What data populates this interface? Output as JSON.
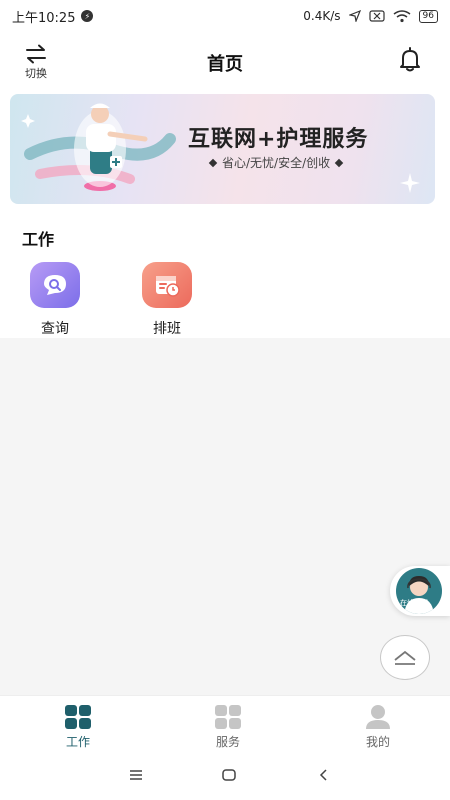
{
  "status": {
    "time": "上午10:25",
    "net_speed": "0.4K/s",
    "battery": "96"
  },
  "header": {
    "switch_label": "切换",
    "title": "首页"
  },
  "banner": {
    "title": "互联网+护理服务",
    "subtitle": "省心/无忧/安全/创收"
  },
  "work": {
    "section_title": "工作",
    "items": [
      {
        "label": "查询",
        "icon": "search-chat-icon"
      },
      {
        "label": "排班",
        "icon": "calendar-clock-icon"
      }
    ]
  },
  "customer_service": {
    "label": "在线客服"
  },
  "tabs": [
    {
      "label": "工作",
      "active": true
    },
    {
      "label": "服务",
      "active": false
    },
    {
      "label": "我的",
      "active": false
    }
  ],
  "colors": {
    "accent": "#1f5f6b",
    "tab_inactive": "#c5c5c5",
    "query": "#8d7bef",
    "schedule": "#ef7563"
  }
}
